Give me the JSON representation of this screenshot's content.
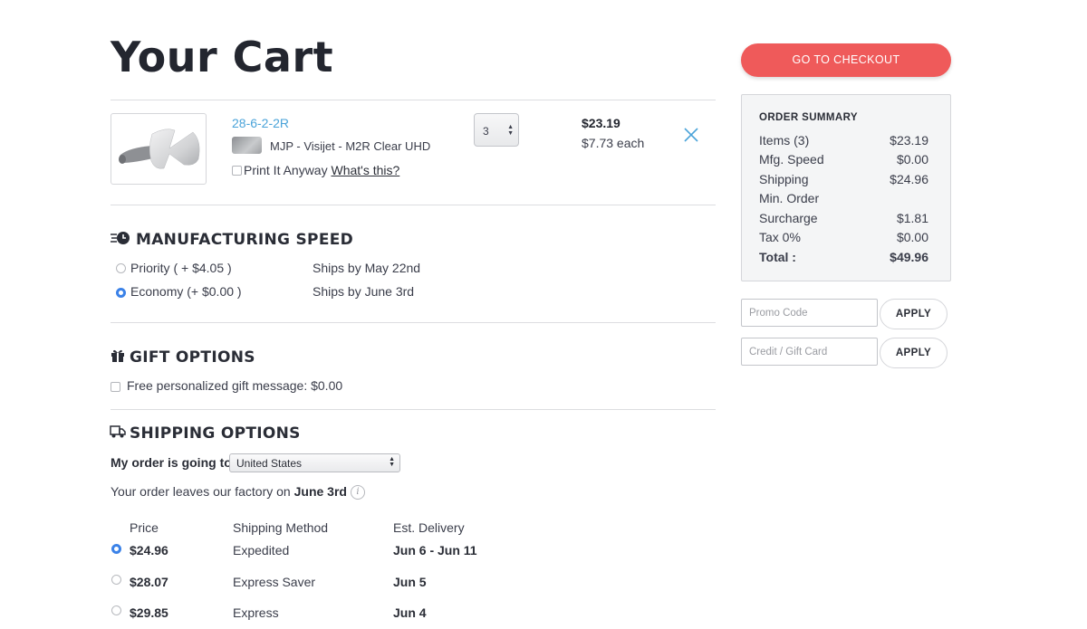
{
  "page": {
    "title": "Your Cart"
  },
  "cart_item": {
    "name": "28-6-2-2R",
    "material": "MJP - Visijet - M2R Clear UHD",
    "print_anyway_label": "Print It Anyway",
    "whats_this_label": "What's this?",
    "quantity": "3",
    "total_price": "$23.19",
    "unit_price": "$7.73 each"
  },
  "manufacturing": {
    "title": "MANUFACTURING SPEED",
    "options": [
      {
        "label": "Priority ( + $4.05 )",
        "ships": "Ships by May 22nd",
        "selected": false
      },
      {
        "label": "Economy (+ $0.00 )",
        "ships": "Ships by June 3rd",
        "selected": true
      }
    ]
  },
  "gift": {
    "title": "GIFT OPTIONS",
    "message_label": "Free personalized gift message: $0.00"
  },
  "shipping": {
    "title": "SHIPPING OPTIONS",
    "going_to_label": "My order is going to",
    "country": "United States",
    "leaves_prefix": "Your order leaves our factory on",
    "leaves_date": "June 3rd",
    "headers": {
      "price": "Price",
      "method": "Shipping Method",
      "delivery": "Est. Delivery"
    },
    "rows": [
      {
        "price": "$24.96",
        "method": "Expedited",
        "delivery": "Jun 6 - Jun 11",
        "selected": true
      },
      {
        "price": "$28.07",
        "method": "Express Saver",
        "delivery": "Jun 5",
        "selected": false
      },
      {
        "price": "$29.85",
        "method": "Express",
        "delivery": "Jun 4",
        "selected": false
      }
    ]
  },
  "summary": {
    "checkout_label": "GO TO CHECKOUT",
    "title": "ORDER SUMMARY",
    "items_label": "Items (3)",
    "items_value": "$23.19",
    "mfg_label": "Mfg. Speed",
    "mfg_value": "$0.00",
    "shipping_label": "Shipping",
    "shipping_value": "$24.96",
    "min_order_label": "Min. Order",
    "surcharge_label": "Surcharge",
    "surcharge_value": "$1.81",
    "tax_label": "Tax 0%",
    "tax_value": "$0.00",
    "total_label": "Total :",
    "total_value": "$49.96"
  },
  "promo": {
    "promo_placeholder": "Promo Code",
    "gift_placeholder": "Credit / Gift Card",
    "apply_label": "APPLY"
  },
  "colors": {
    "accent": "#ef5a5a",
    "link": "#4aa3d9",
    "radio_selected": "#3b82e8",
    "summary_bg": "#f4f5f6"
  }
}
